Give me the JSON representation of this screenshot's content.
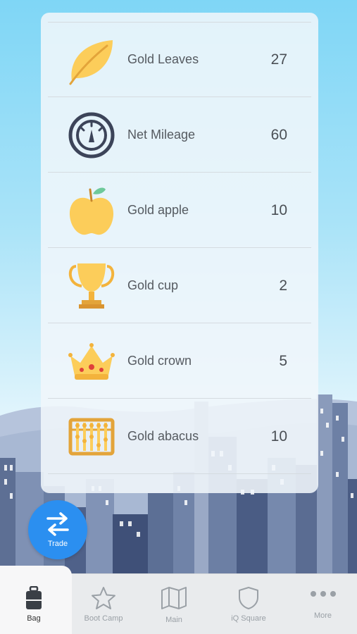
{
  "items": [
    {
      "icon": "gold-leaf-icon",
      "name": "Gold Leaves",
      "count": "27"
    },
    {
      "icon": "gauge-icon",
      "name": "Net Mileage",
      "count": "60"
    },
    {
      "icon": "gold-apple-icon",
      "name": "Gold apple",
      "count": "10"
    },
    {
      "icon": "gold-cup-icon",
      "name": "Gold cup",
      "count": "2"
    },
    {
      "icon": "gold-crown-icon",
      "name": "Gold crown",
      "count": "5"
    },
    {
      "icon": "gold-abacus-icon",
      "name": "Gold abacus",
      "count": "10"
    }
  ],
  "trade": {
    "label": "Trade",
    "icon": "swap-arrows-icon"
  },
  "tabs": [
    {
      "label": "Bag",
      "icon": "bag-icon",
      "active": true
    },
    {
      "label": "Boot Camp",
      "icon": "star-icon",
      "active": false
    },
    {
      "label": "Main",
      "icon": "map-icon",
      "active": false
    },
    {
      "label": "iQ Square",
      "icon": "shield-icon",
      "active": false
    },
    {
      "label": "More",
      "icon": "more-dots-icon",
      "active": false
    }
  ],
  "colors": {
    "accent": "#2b8ff0",
    "gold": "#fccd5a",
    "gold_dark": "#e3a43a",
    "text": "#555a60"
  }
}
